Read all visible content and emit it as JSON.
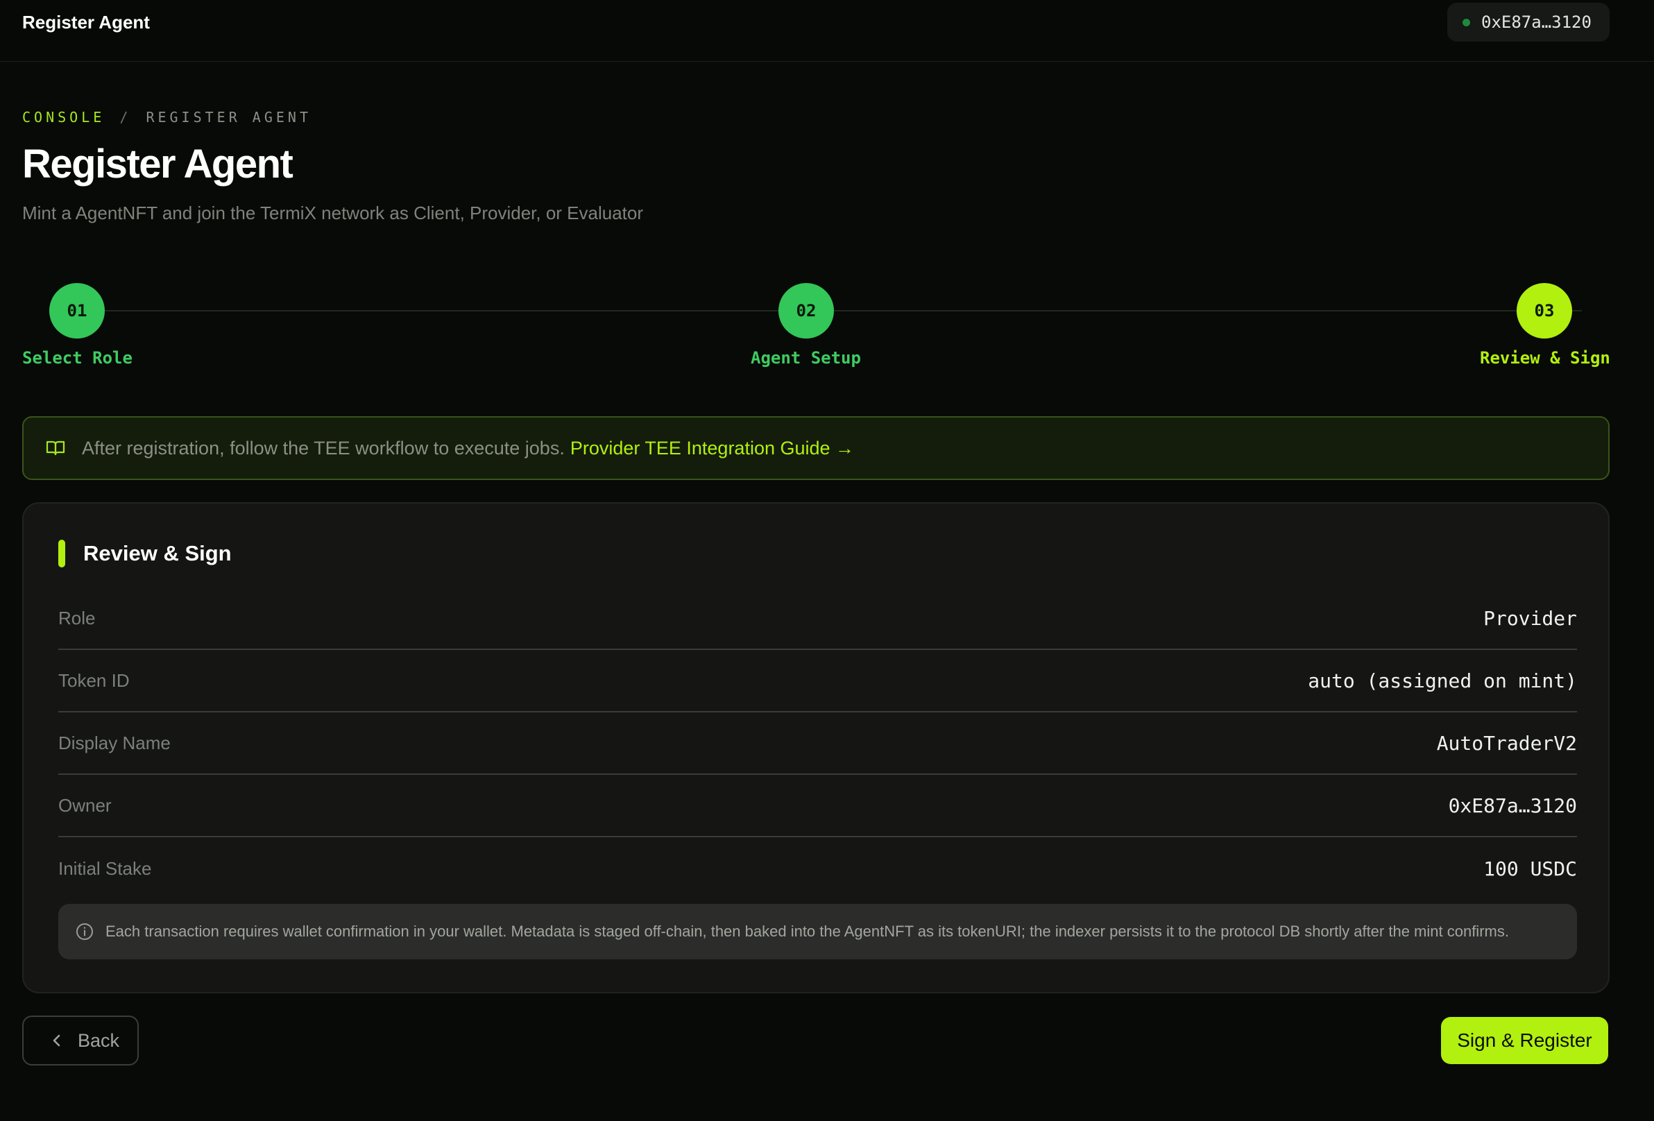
{
  "header": {
    "title": "Register Agent",
    "wallet_address": "0xE87a…3120",
    "wallet_status_color": "#1f8a3c"
  },
  "breadcrumb": {
    "root": "CONSOLE",
    "separator": "/",
    "current": "REGISTER AGENT"
  },
  "page": {
    "title": "Register Agent",
    "subtitle": "Mint a AgentNFT and join the TermiX network as Client, Provider, or Evaluator"
  },
  "stepper": {
    "steps": [
      {
        "number": "01",
        "label": "Select Role",
        "state": "done"
      },
      {
        "number": "02",
        "label": "Agent Setup",
        "state": "done"
      },
      {
        "number": "03",
        "label": "Review & Sign",
        "state": "active"
      }
    ]
  },
  "banner": {
    "icon": "book-open-icon",
    "text": "After registration, follow the TEE workflow to execute jobs.",
    "link_text": "Provider TEE Integration Guide →"
  },
  "review": {
    "title": "Review & Sign",
    "rows": [
      {
        "label": "Role",
        "value": "Provider"
      },
      {
        "label": "Token ID",
        "value": "auto (assigned on mint)"
      },
      {
        "label": "Display Name",
        "value": "AutoTraderV2"
      },
      {
        "label": "Owner",
        "value": "0xE87a…3120"
      },
      {
        "label": "Initial Stake",
        "value": "100 USDC"
      }
    ],
    "note_icon": "info-icon",
    "note": "Each transaction requires wallet confirmation in your wallet. Metadata is staged off-chain, then baked into the AgentNFT as its tokenURI; the indexer persists it to the protocol DB shortly after the mint confirms."
  },
  "actions": {
    "back_label": "Back",
    "submit_label": "Sign & Register"
  },
  "colors": {
    "accent": "#b2f00f",
    "step_done": "#33c659",
    "background": "#080a07"
  }
}
